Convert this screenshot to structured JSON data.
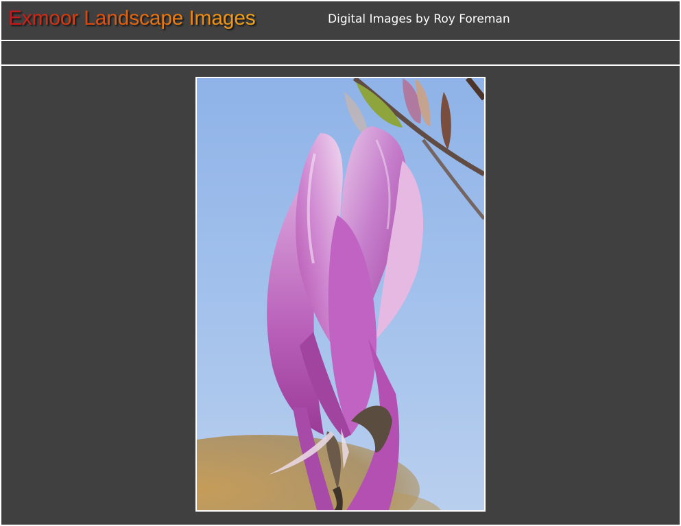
{
  "header": {
    "site_title": "Exmoor Landscape Images",
    "subtitle": "Digital Images by Roy Foreman"
  },
  "main": {
    "photo": {
      "subject": "magnolia-flower"
    }
  },
  "colors": {
    "background": "#404040",
    "border": "#ffffff",
    "title_gradient_start": "#c8141b",
    "title_gradient_end": "#f2a418",
    "subtitle": "#ffffff"
  }
}
